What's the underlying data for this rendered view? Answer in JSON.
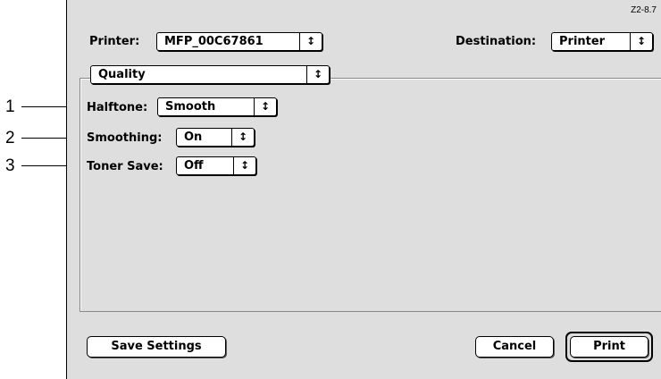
{
  "figure_id": "Z2-8.7",
  "refs": [
    "1",
    "2",
    "3"
  ],
  "printer": {
    "label": "Printer:",
    "value": "MFP_00C67861"
  },
  "destination": {
    "label": "Destination:",
    "value": "Printer"
  },
  "section": {
    "value": "Quality"
  },
  "settings": {
    "halftone": {
      "label": "Halftone:",
      "value": "Smooth"
    },
    "smoothing": {
      "label": "Smoothing:",
      "value": "On"
    },
    "toner_save": {
      "label": "Toner Save:",
      "value": "Off"
    }
  },
  "buttons": {
    "save_settings": "Save Settings",
    "cancel": "Cancel",
    "print": "Print"
  },
  "icons": {
    "popup_arrow": "up-down-arrows-icon"
  }
}
